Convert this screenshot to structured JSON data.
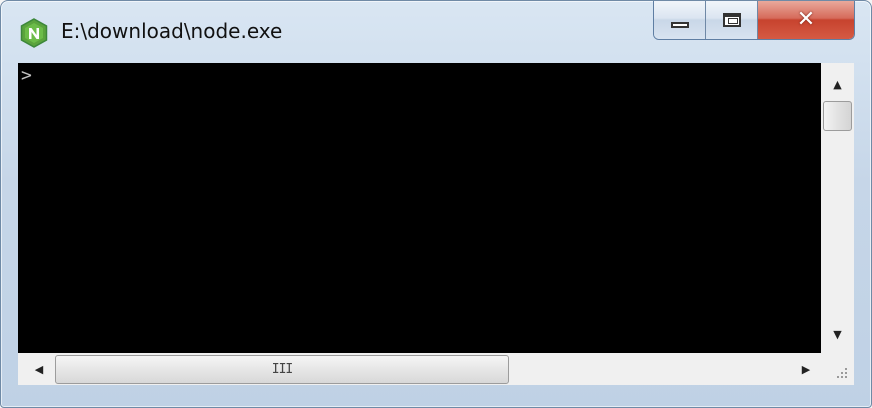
{
  "window": {
    "title": "E:\\download\\node.exe",
    "app_icon": "nodejs-hexagon-icon",
    "accent_color": "#3c873a"
  },
  "caption_buttons": {
    "minimize_icon": "minimize-icon",
    "maximize_icon": "maximize-icon",
    "close_icon": "close-icon",
    "close_glyph": "✕"
  },
  "console": {
    "prompt": ">",
    "output": ""
  },
  "scrollbars": {
    "vertical": {
      "up_glyph": "▲",
      "down_glyph": "▼"
    },
    "horizontal": {
      "left_glyph": "◀",
      "right_glyph": "▶",
      "grip_glyph": "III"
    }
  }
}
